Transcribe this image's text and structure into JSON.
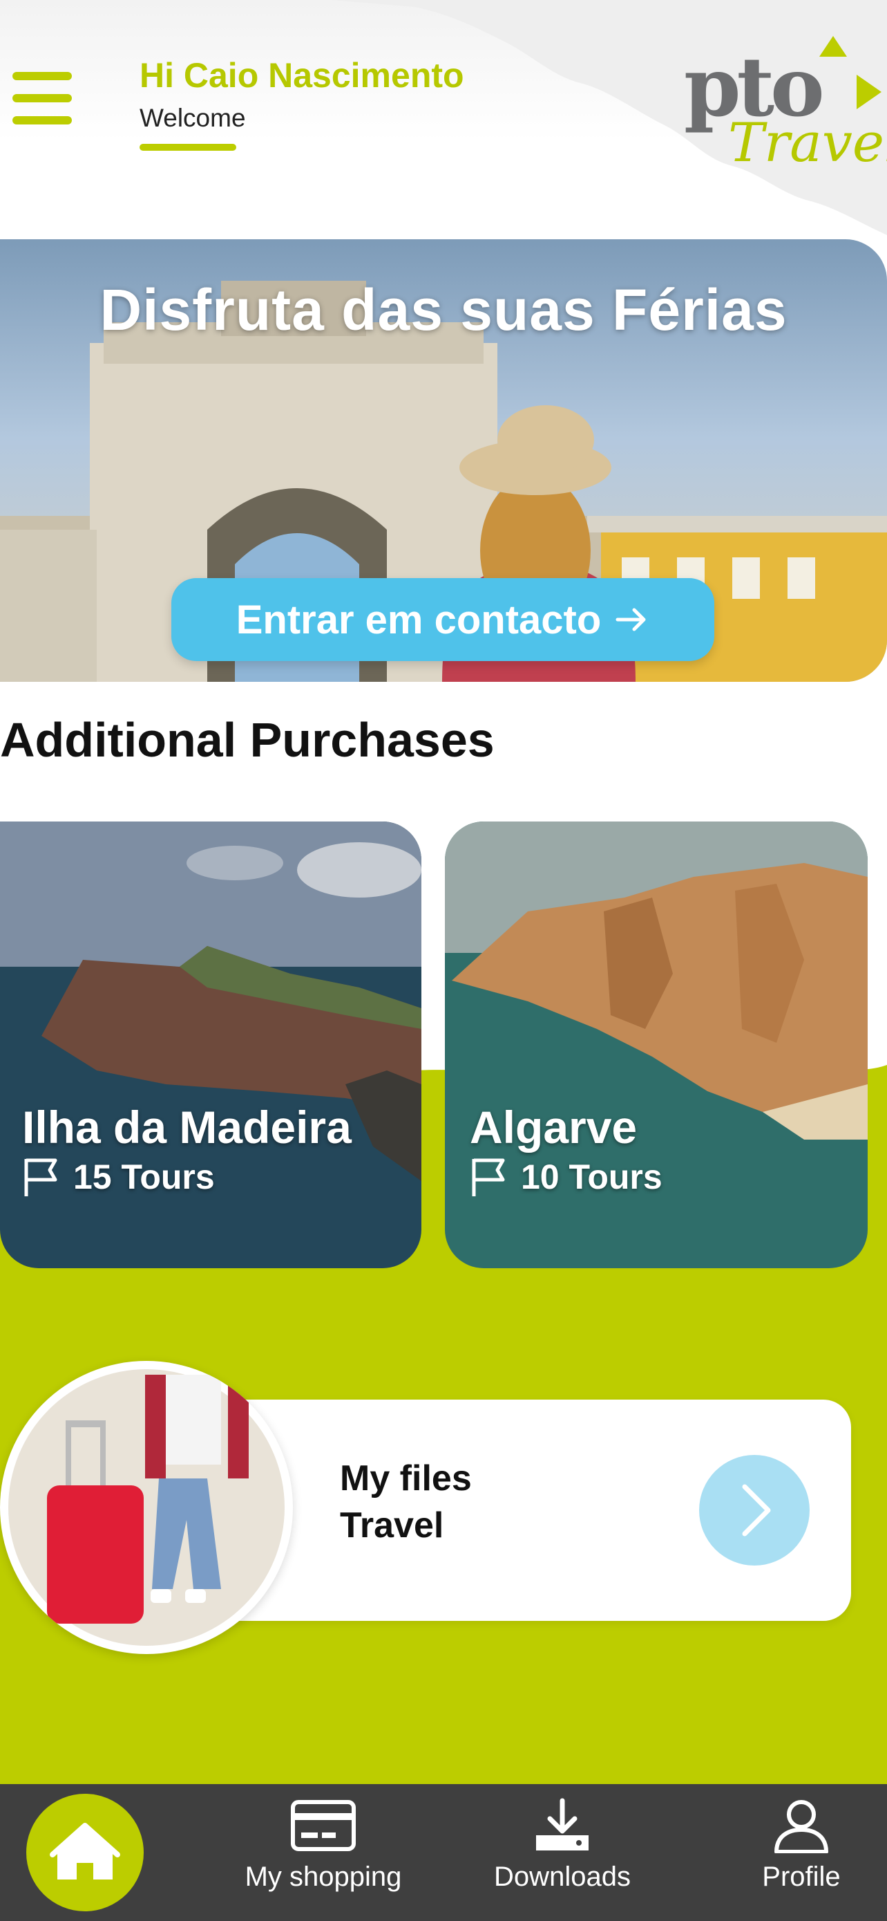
{
  "header": {
    "greeting": "Hi Caio Nascimento",
    "subtitle": "Welcome",
    "logo_text_top": "pto",
    "logo_text_bottom": "Travel",
    "colors": {
      "accent": "#bccd00",
      "logo_gray": "#6d6e70"
    }
  },
  "hero": {
    "title": "Disfruta das suas Férias",
    "button_label": "Entrar em contacto",
    "button_icon": "arrow-right-icon",
    "colors": {
      "button": "#4fc2ea"
    }
  },
  "additional_purchases": {
    "title": "Additional Purchases",
    "items": [
      {
        "name": "Ilha da Madeira",
        "tours": "15 Tours",
        "icon": "flag-icon"
      },
      {
        "name": "Algarve",
        "tours": "10 Tours",
        "icon": "flag-icon"
      }
    ]
  },
  "files": {
    "label_line1": "My files",
    "label_line2": "Travel",
    "arrow_icon": "chevron-right-icon",
    "colors": {
      "arrow_bg": "#a9dff3"
    }
  },
  "bottom_nav": {
    "items": [
      {
        "label": "",
        "icon": "home-icon"
      },
      {
        "label": "My shopping",
        "icon": "credit-card-icon"
      },
      {
        "label": "Downloads",
        "icon": "download-icon"
      },
      {
        "label": "Profile",
        "icon": "user-icon"
      }
    ],
    "colors": {
      "background": "#3f3f3f",
      "home_bg": "#bccd00"
    }
  }
}
